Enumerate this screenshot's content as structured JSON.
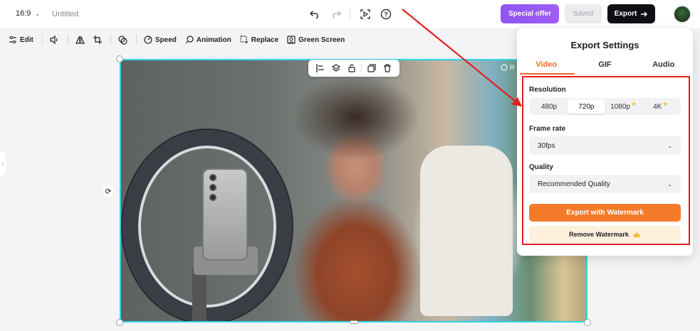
{
  "topbar": {
    "aspect_ratio": "16:9",
    "project_title": "Untitled",
    "special_offer_label": "Special offer",
    "saved_label": "Saved",
    "export_label": "Export",
    "icons": [
      "undo-icon",
      "redo-icon",
      "preview-icon",
      "help-icon",
      "chevron-down-icon",
      "arrow-right-icon"
    ]
  },
  "toolbar": {
    "items": [
      {
        "label": "Edit",
        "icon": "sliders-icon"
      },
      {
        "label": "",
        "icon": "volume-icon"
      },
      {
        "label": "",
        "icon": "flip-icon"
      },
      {
        "label": "",
        "icon": "crop-icon"
      },
      {
        "label": "",
        "icon": "mask-icon"
      },
      {
        "label": "Speed",
        "icon": "speed-icon"
      },
      {
        "label": "Animation",
        "icon": "animation-icon"
      },
      {
        "label": "Replace",
        "icon": "replace-icon"
      },
      {
        "label": "Green Screen",
        "icon": "green-screen-icon"
      }
    ]
  },
  "canvas": {
    "overlay_label": "R",
    "floating_tools": [
      "align-icon",
      "layers-icon",
      "lock-icon",
      "duplicate-icon",
      "delete-icon"
    ]
  },
  "export_panel": {
    "title": "Export Settings",
    "tabs": [
      {
        "label": "Video",
        "active": true
      },
      {
        "label": "GIF",
        "active": false
      },
      {
        "label": "Audio",
        "active": false
      }
    ],
    "resolution": {
      "label": "Resolution",
      "options": [
        {
          "label": "480p",
          "premium": false,
          "active": false
        },
        {
          "label": "720p",
          "premium": false,
          "active": true
        },
        {
          "label": "1080p",
          "premium": true,
          "active": false
        },
        {
          "label": "4K",
          "premium": true,
          "active": false
        }
      ]
    },
    "frame_rate": {
      "label": "Frame rate",
      "value": "30fps"
    },
    "quality": {
      "label": "Quality",
      "value": "Recommended Quality"
    },
    "export_watermark_label": "Export with Watermark",
    "remove_watermark_label": "Remove Watermark"
  },
  "colors": {
    "accent_orange": "#f06a24",
    "export_button_orange": "#f47b2a",
    "offer_purple": "#9a58f4",
    "selection_cyan": "#2dd4e6",
    "annotation_red": "#e41e1e",
    "premium_star": "#f5c23a"
  }
}
